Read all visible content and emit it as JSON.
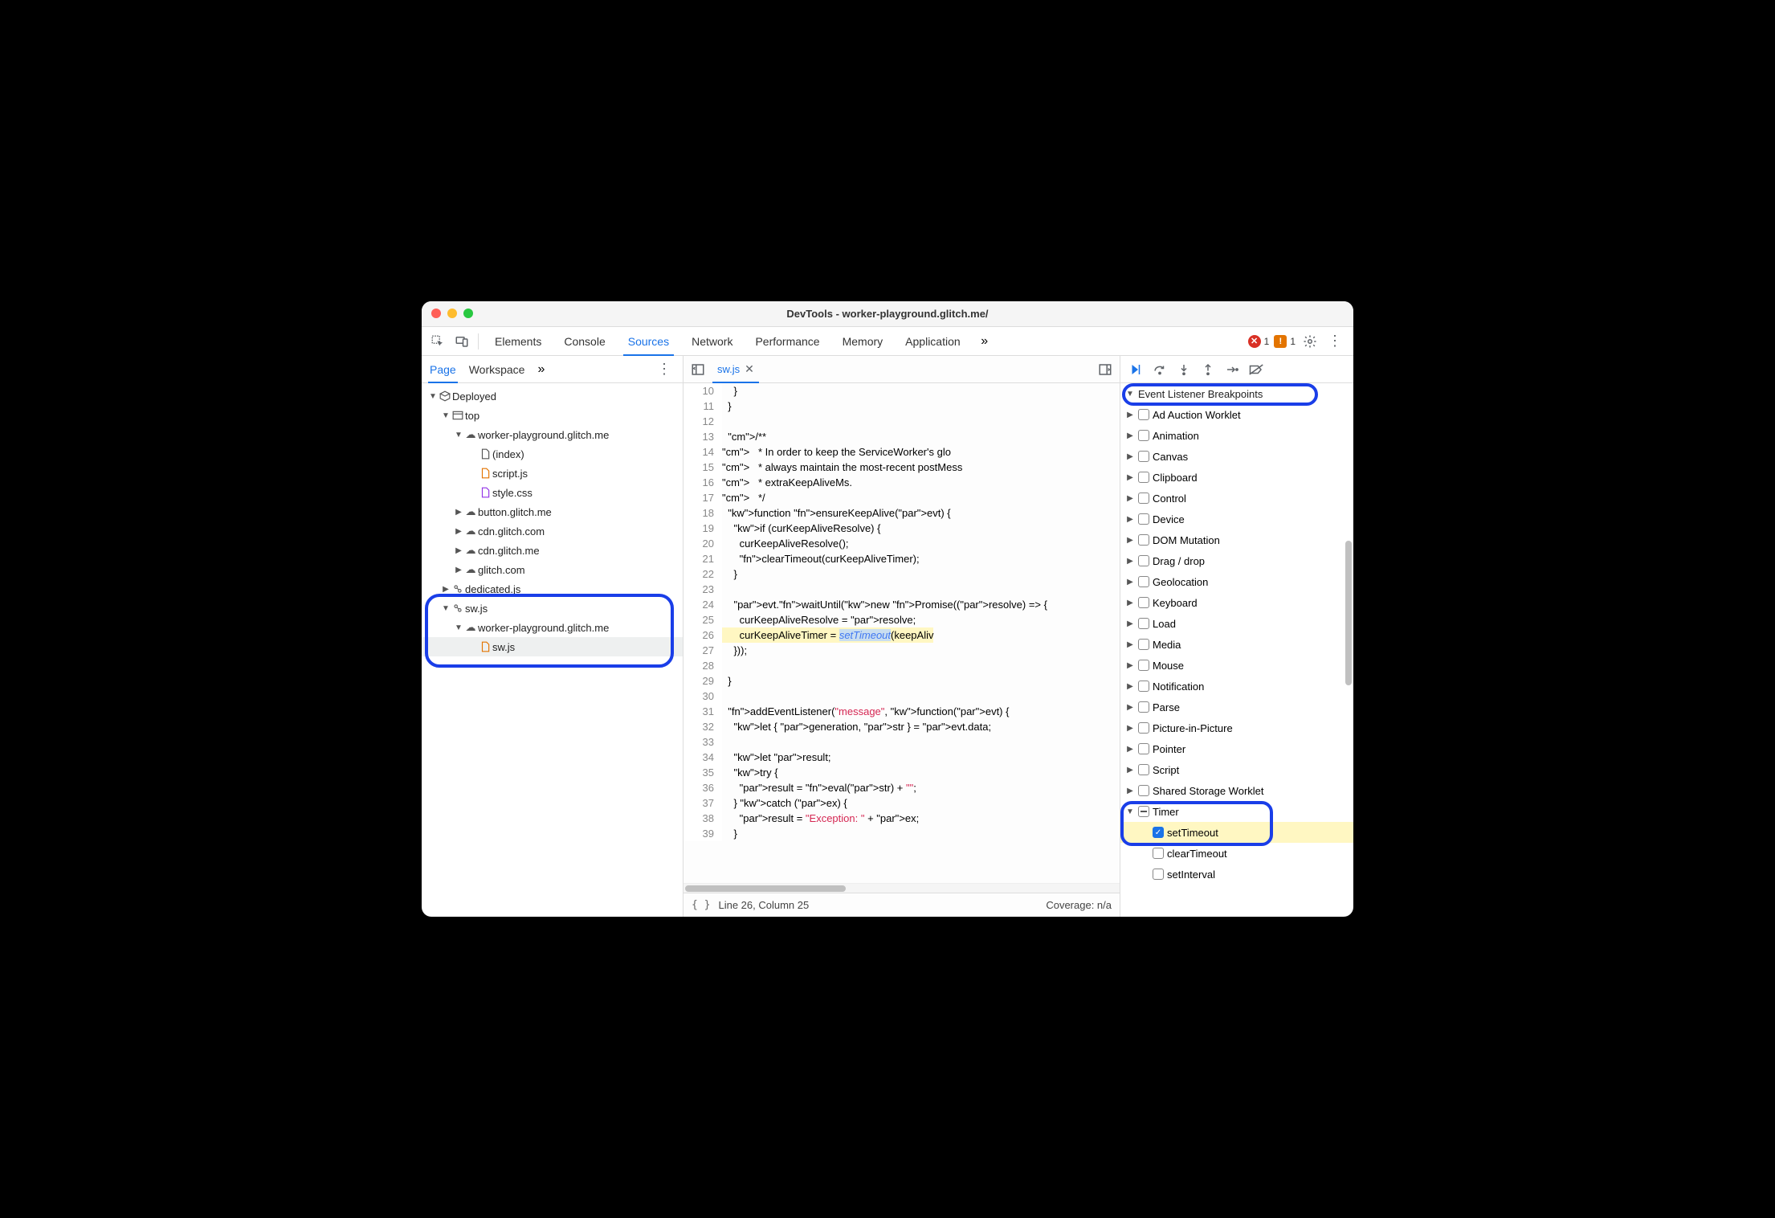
{
  "window": {
    "title": "DevTools - worker-playground.glitch.me/"
  },
  "toolbar": {
    "tabs": [
      "Elements",
      "Console",
      "Sources",
      "Network",
      "Performance",
      "Memory",
      "Application"
    ],
    "activeTab": "Sources",
    "more": "»",
    "errors": {
      "count": "1"
    },
    "warnings": {
      "count": "1"
    }
  },
  "leftPanel": {
    "tabs": {
      "page": "Page",
      "workspace": "Workspace",
      "more": "»"
    },
    "tree": {
      "deployed": "Deployed",
      "top": "top",
      "wpg": "worker-playground.glitch.me",
      "index": "(index)",
      "script": "script.js",
      "style": "style.css",
      "button": "button.glitch.me",
      "cdncom": "cdn.glitch.com",
      "cdnme": "cdn.glitch.me",
      "glitch": "glitch.com",
      "dedicated": "dedicated.js",
      "swjs_root": "sw.js",
      "wpg2": "worker-playground.glitch.me",
      "swjs": "sw.js"
    }
  },
  "editor": {
    "fileTab": "sw.js",
    "startLine": 10,
    "lines": [
      "    }",
      "  }",
      "",
      "  /**",
      "   * In order to keep the ServiceWorker's glo",
      "   * always maintain the most-recent postMess",
      "   * extraKeepAliveMs.",
      "   */",
      "  function ensureKeepAlive(evt) {",
      "    if (curKeepAliveResolve) {",
      "      curKeepAliveResolve();",
      "      clearTimeout(curKeepAliveTimer);",
      "    }",
      "",
      "    evt.waitUntil(new Promise((resolve) => {",
      "      curKeepAliveResolve = resolve;",
      "      curKeepAliveTimer = setTimeout(keepAliv",
      "    }));",
      "",
      "  }",
      "",
      "  addEventListener(\"message\", function(evt) {",
      "    let { generation, str } = evt.data;",
      "",
      "    let result;",
      "    try {",
      "      result = eval(str) + \"\";",
      "    } catch (ex) {",
      "      result = \"Exception: \" + ex;",
      "    }"
    ],
    "status": {
      "pos": "Line 26, Column 25",
      "coverage": "Coverage: n/a"
    }
  },
  "right": {
    "header": "Event Listener Breakpoints",
    "cats": [
      "Ad Auction Worklet",
      "Animation",
      "Canvas",
      "Clipboard",
      "Control",
      "Device",
      "DOM Mutation",
      "Drag / drop",
      "Geolocation",
      "Keyboard",
      "Load",
      "Media",
      "Mouse",
      "Notification",
      "Parse",
      "Picture-in-Picture",
      "Pointer",
      "Script",
      "Shared Storage Worklet"
    ],
    "timer": {
      "label": "Timer",
      "items": [
        "setTimeout",
        "clearTimeout",
        "setInterval"
      ],
      "checked": "setTimeout"
    }
  }
}
